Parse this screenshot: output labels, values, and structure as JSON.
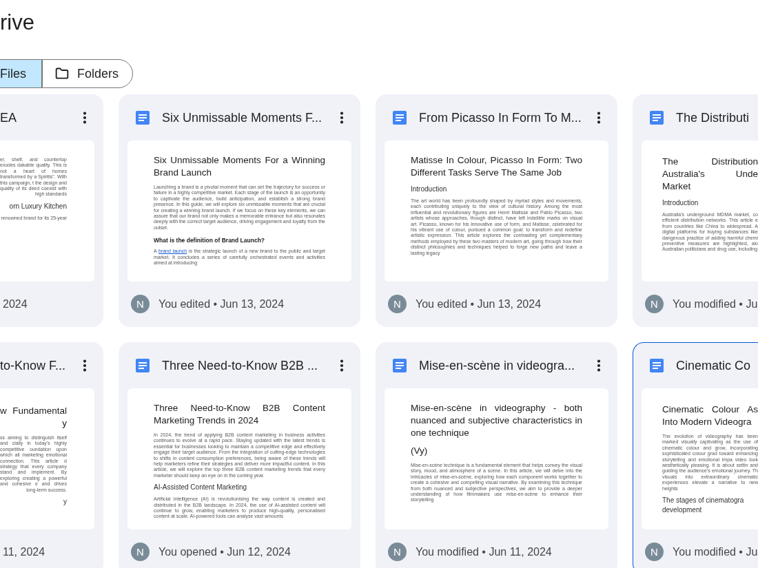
{
  "app_title": "rive",
  "view_toggle": [
    {
      "label": "Files",
      "selected": true
    },
    {
      "label": "Folders",
      "selected": false
    }
  ],
  "rows": [
    {
      "cards": [
        {
          "kind": "cut_left",
          "selected": false,
          "title": "EA",
          "footer": "2024",
          "preview": [
            {
              "kind": "body",
              "text": "er, shelf, and countertop exudes dakable quality. This is not a heart of homes transformed by a Spiritis\". With this campaign, t the design and quality of its deed coexist with high standards"
            },
            {
              "kind": "subheading",
              "text": "orn Luxury Kitchen"
            },
            {
              "kind": "body",
              "text": "renowned brand for its 25-year"
            }
          ]
        },
        {
          "kind": "full",
          "selected": false,
          "title": "Six Unmissable Moments F...",
          "avatar": "N",
          "footer": "You edited • Jun 13, 2024",
          "preview": [
            {
              "kind": "doc_title",
              "text": "Six Unmissable Moments For a Winning Brand Launch"
            },
            {
              "kind": "body",
              "text": "Launching a brand is a pivotal moment that can set the trajectory for success or failure in a highly competitive market. Each stage of the launch is an opportunity to captivate the audience, build anticipation, and establish a strong brand presence. In this guide, we will explore six unmissable moments that are crucial for creating a winning brand launch. If we focus on these key elements, we can assure that our brand not only makes a memorable entrance but also resonates deeply with the correct target audience, driving engagement and loyalty from the outset."
            },
            {
              "kind": "heading_bold",
              "text": "What is the definition of Brand Launch?"
            },
            {
              "kind": "body_link",
              "before": "A ",
              "link": "brand launch",
              "after": " is the strategic launch of a new brand to the public and target market. It concludes a series of carefully orchestrated events and activities aimed at introducing"
            }
          ]
        },
        {
          "kind": "full",
          "selected": false,
          "title": "From Picasso In Form To M...",
          "avatar": "N",
          "footer": "You edited • Jun 13, 2024",
          "preview": [
            {
              "kind": "doc_title",
              "text": "Matisse In Colour, Picasso In Form: Two Different Tasks Serve The Same Job"
            },
            {
              "kind": "subheading",
              "text": "Introduction"
            },
            {
              "kind": "body",
              "text": "The art world has been profoundly shaped by myriad styles and movements, each contributing uniquely to the view of cultural history. Among the most influential and revolutionary figures are Henri Matisse and Pablo Picasso, two artists whose approaches, though distinct, have left indelible marks on visual art. Picasso, known for his innovative use of form, and Matisse, celebrated for his vibrant use of colour, pursued a common goal: to transform and redefine artistic expression. This article explores the contrasting yet complementary methods employed by these two masters of modern art, going through how their distinct philosophies and techniques helped to forge new paths and leave a lasting legacy"
            }
          ]
        },
        {
          "kind": "cut_right",
          "selected": false,
          "title": "The Distributi",
          "avatar": "N",
          "footer": "You modified • Ju",
          "preview": [
            {
              "kind": "doc_title",
              "text": "The Distribution Australia's Unde Market"
            },
            {
              "kind": "subheading",
              "text": "Introduction"
            },
            {
              "kind": "body",
              "text": "Australia's underground MDMA market, co efficient distribution networks. This article e from countries like China to widespread. A digital platforms for buying substances like dangerous practice of adding harmful chemi preventive measures are highlighted, alo Australian politicians and drug use, including"
            }
          ]
        }
      ]
    },
    {
      "cards": [
        {
          "kind": "cut_left",
          "selected": false,
          "title": "to-Know F...",
          "footer": "11, 2024",
          "preview": [
            {
              "kind": "doc_title",
              "text": "w Fundamental y"
            },
            {
              "kind": "body",
              "text": "ss aiming to distinguish itself and cially in today's highly competitive oundation upon which all marketing emotional connection. This article d strategy that every company stand and implement. By exploring creating a powerful and cohesive e and drives long-term success."
            },
            {
              "kind": "subheading",
              "text": "y"
            }
          ]
        },
        {
          "kind": "full",
          "selected": false,
          "title": "Three Need-to-Know B2B ...",
          "avatar": "N",
          "footer": "You opened • Jun 12, 2024",
          "preview": [
            {
              "kind": "doc_title",
              "text": "Three Need-to-Know B2B Content Marketing Trends in 2024"
            },
            {
              "kind": "body",
              "text": "In 2024, the trend of applying B2B content marketing in business activities continues to evolve at a rapid pace. Staying updated with the latest trends is essential for businesses looking to maintain a competitive edge and effectively engage their target audience. From the integration of cutting-edge technologies to shifts in content consumption preferences, being aware of these trends will help marketers refine their strategies and deliver more impactful content. In this article, we will explore the top three B2B content marketing trends that every marketer should keep an eye on in the coming year."
            },
            {
              "kind": "subheading",
              "text": "AI-Assisted Content Marketing"
            },
            {
              "kind": "body",
              "text": "Artificial Intelligence (AI) is revolutionising the way content is created and distributed in the B2B landscape. In 2024, the use of AI-assisted content will continue to grow, enabling marketers to produce high-quality, personalised content at scale. AI-powered tools can analyse vast amounts"
            }
          ]
        },
        {
          "kind": "full",
          "selected": false,
          "title": "Mise-en-scène in videogra...",
          "avatar": "N",
          "footer": "You modified • Jun 11, 2024",
          "preview": [
            {
              "kind": "doc_title",
              "text": "Mise-en-scène in videography - both nuanced and subjective characteristics in one technique"
            },
            {
              "kind": "doc_title",
              "text": "(Vy)"
            },
            {
              "kind": "body",
              "text": "Mise-en-scène technique is a fundamental element that helps convey the visual story, mood, and atmosphere of a scene. In this article, we will delve into the intricacies of mise-en-scène, exploring how each component works together to create a cohesive and compelling visual narrative. By examining this technique from both nuanced and subjective perspectives, we aim to provide a deeper understanding of how filmmakers use mise-en-scène to enhance their storytelling"
            }
          ]
        },
        {
          "kind": "cut_right",
          "selected": true,
          "title": "Cinematic Co",
          "avatar": "N",
          "footer": "You modified • Ju",
          "preview": [
            {
              "kind": "doc_title",
              "text": "Cinematic Colour As Into Modern Videogra"
            },
            {
              "kind": "body",
              "text": "The evolution of videography has been marked visually captivating as the use of cinematic colour and grow, incorporating sophisticated colour grad toward enhancing storytelling and emotional impa video look aesthetically pleasing. It is about settin and guiding the audience's emotional journey. Th visuals into extraordinary cinematic experiences elevate a narrative to new heights"
            },
            {
              "kind": "subheading",
              "text": "The stages of cinematogra development"
            }
          ]
        }
      ]
    }
  ]
}
